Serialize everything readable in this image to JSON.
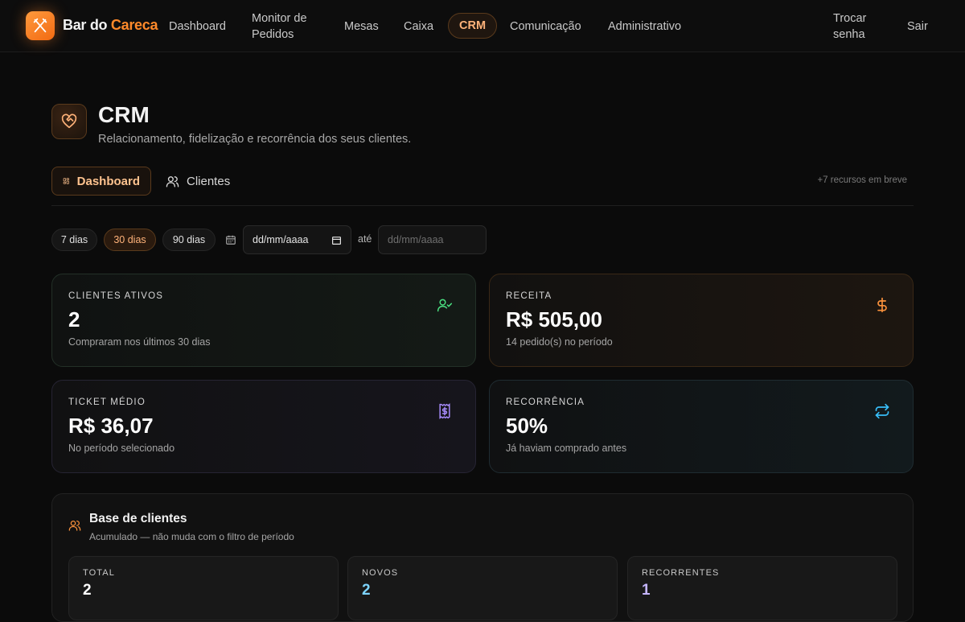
{
  "app": {
    "name_part1": "Bar do ",
    "name_part2": "Careca",
    "accent_color": "#ff8a2a"
  },
  "nav": {
    "items": [
      {
        "label": "Dashboard"
      },
      {
        "label": "Monitor de Pedidos"
      },
      {
        "label": "Mesas"
      },
      {
        "label": "Caixa"
      },
      {
        "label": "CRM",
        "active": true
      },
      {
        "label": "Comunicação"
      },
      {
        "label": "Administrativo"
      }
    ],
    "change_password": "Trocar senha",
    "logout": "Sair"
  },
  "header": {
    "icon": "heart-handshake-icon",
    "title": "CRM",
    "subtitle": "Relacionamento, fidelização e recorrência dos seus clientes."
  },
  "tabs": [
    {
      "label": "Dashboard",
      "icon": "dashboard-icon",
      "active": true
    },
    {
      "label": "Clientes",
      "icon": "users-icon",
      "active": false
    }
  ],
  "coming_soon": "+7 recursos em breve",
  "filters": {
    "ranges": [
      {
        "label": "7 dias"
      },
      {
        "label": "30 dias",
        "active": true
      },
      {
        "label": "90 dias"
      }
    ],
    "date_from": {
      "value": "dd/mm/aaaa"
    },
    "between": "até",
    "date_to": {
      "value": "dd/mm/aaaa"
    }
  },
  "stats": [
    {
      "label": "CLIENTES ATIVOS",
      "value": "2",
      "caption": "Compraram nos últimos 30 dias",
      "icon": "user-check-icon",
      "color": "#4ade80"
    },
    {
      "label": "RECEITA",
      "value": "R$ 505,00",
      "caption": "14 pedido(s) no período",
      "icon": "dollar-icon",
      "color": "#fb923c"
    },
    {
      "label": "TICKET MÉDIO",
      "value": "R$ 36,07",
      "caption": "No período selecionado",
      "icon": "receipt-icon",
      "color": "#a78bfa"
    },
    {
      "label": "RECORRÊNCIA",
      "value": "50%",
      "caption": "Já haviam comprado antes",
      "icon": "repeat-icon",
      "color": "#38bdf8"
    }
  ],
  "base": {
    "title": "Base de clientes",
    "subtitle": "Acumulado — não muda com o filtro de período",
    "items": [
      {
        "label": "TOTAL",
        "value": "2",
        "color": "#ffffff"
      },
      {
        "label": "NOVOS",
        "value": "2",
        "color": "#7dd3fc"
      },
      {
        "label": "RECORRENTES",
        "value": "1",
        "color": "#c4b5fd"
      }
    ]
  }
}
